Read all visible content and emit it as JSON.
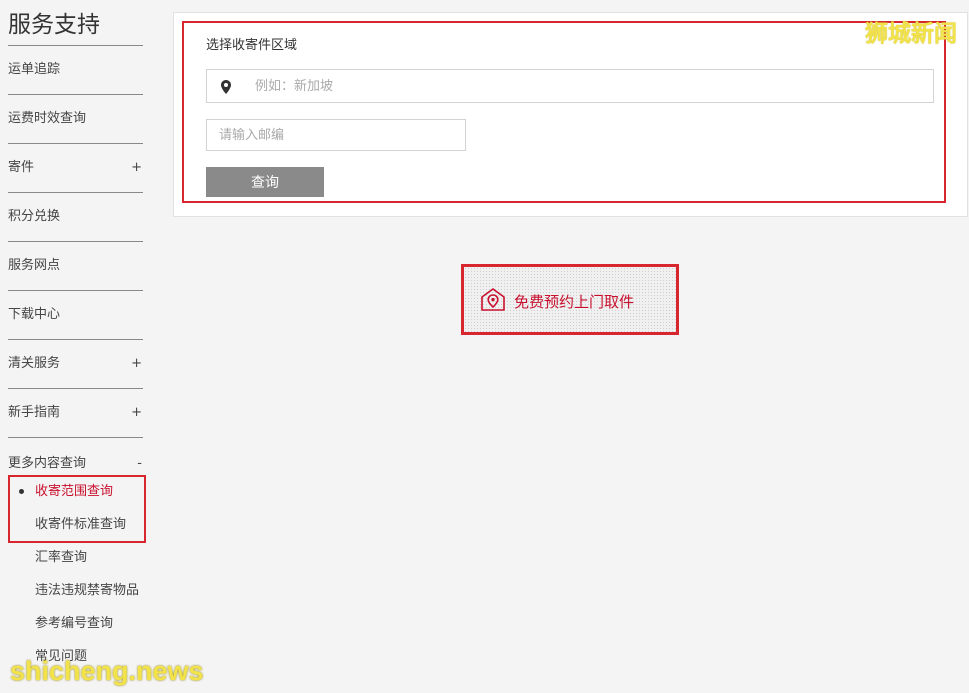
{
  "sidebar": {
    "title": "服务支持",
    "items": [
      {
        "label": "运单追踪",
        "toggle": ""
      },
      {
        "label": "运费时效查询",
        "toggle": ""
      },
      {
        "label": "寄件",
        "toggle": "+"
      },
      {
        "label": "积分兑换",
        "toggle": ""
      },
      {
        "label": "服务网点",
        "toggle": ""
      },
      {
        "label": "下载中心",
        "toggle": ""
      },
      {
        "label": "清关服务",
        "toggle": "+"
      },
      {
        "label": "新手指南",
        "toggle": "+"
      },
      {
        "label": "更多内容查询",
        "toggle": "-"
      }
    ],
    "sub_items": [
      {
        "label": "收寄范围查询"
      },
      {
        "label": "收寄件标准查询"
      },
      {
        "label": "汇率查询"
      },
      {
        "label": "违法违规禁寄物品"
      },
      {
        "label": "参考编号查询"
      },
      {
        "label": "常见问题"
      }
    ]
  },
  "form": {
    "section_title": "选择收寄件区域",
    "region_placeholder": "例如：新加坡",
    "region_value": "",
    "postal_placeholder": "请输入邮编",
    "postal_value": "",
    "query_label": "查询"
  },
  "pickup": {
    "label": "免费预约上门取件"
  },
  "watermarks": {
    "top": "狮城新闻",
    "bottom": "shicheng.news"
  },
  "colors": {
    "accent": "#c8102e",
    "highlight_box": "#d7262e",
    "button_gray": "#8a8a8a"
  }
}
